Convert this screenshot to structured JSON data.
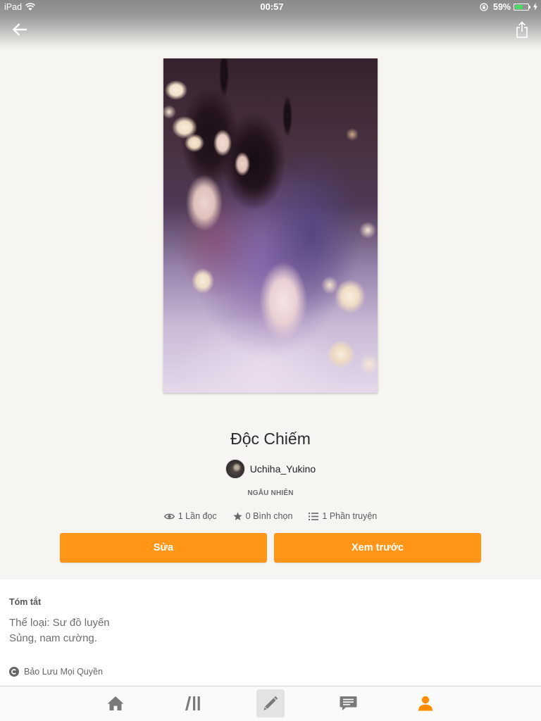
{
  "status_bar": {
    "device": "iPad",
    "time": "00:57",
    "battery": "59%"
  },
  "header": {
    "back_icon": "back-arrow-icon",
    "share_icon": "share-icon"
  },
  "story": {
    "title": "Độc Chiếm",
    "author": "Uchiha_Yukino",
    "category": "NGẪU NHIÊN",
    "stats": [
      {
        "icon": "eye-icon",
        "text": "1 Lần đọc"
      },
      {
        "icon": "star-icon",
        "text": "0 Bình chọn"
      },
      {
        "icon": "list-icon",
        "text": "1 Phần truyện"
      }
    ]
  },
  "actions": {
    "edit_label": "Sửa",
    "preview_label": "Xem trước"
  },
  "summary": {
    "heading": "Tóm tắt",
    "lines": [
      "Thể loại: Sư đồ luyến",
      "Sủng, nam cường."
    ],
    "copyright_icon": "copyright-icon",
    "copyright": "Bảo Lưu Mọi Quyền"
  },
  "tabs": [
    {
      "icon": "home-icon",
      "highlighted": false,
      "selected": false
    },
    {
      "icon": "library-icon",
      "highlighted": false,
      "selected": false
    },
    {
      "icon": "pencil-icon",
      "highlighted": true,
      "selected": false
    },
    {
      "icon": "chat-icon",
      "highlighted": false,
      "selected": false
    },
    {
      "icon": "profile-icon",
      "highlighted": false,
      "selected": true
    }
  ],
  "colors": {
    "accent": "#ff9617",
    "background": "#f6f5f1",
    "tab_icon": "#7a7a7a",
    "tab_selected": "#ff8c00",
    "battery": "#4cd964"
  }
}
